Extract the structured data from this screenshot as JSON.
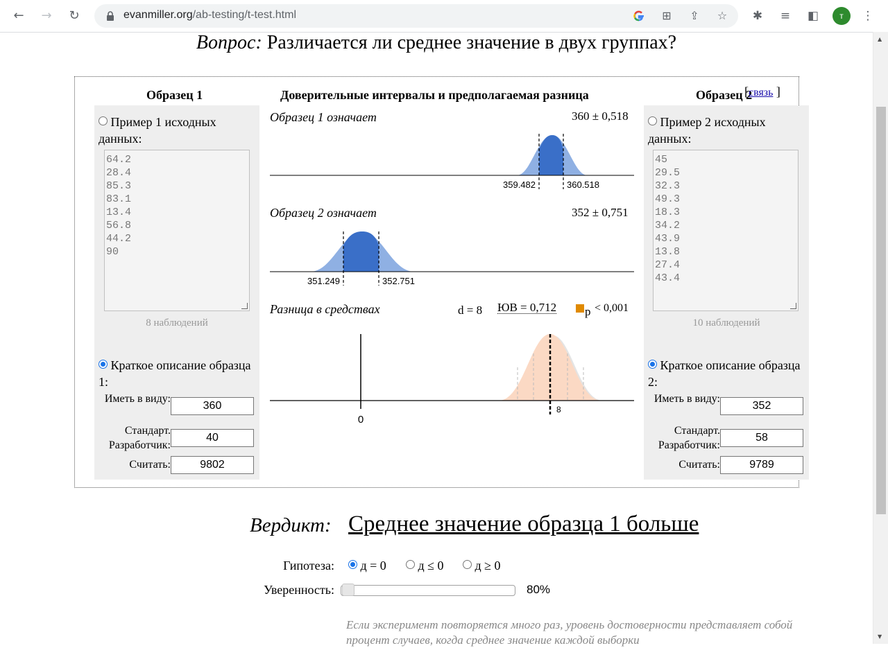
{
  "browser": {
    "url_host": "evanmiller.org",
    "url_path": "/ab-testing/t-test.html",
    "avatar_letter": "т"
  },
  "question": {
    "label": "Вопрос:",
    "text": "Различается ли среднее значение в двух группах?"
  },
  "link": {
    "open": "[",
    "label": "связь",
    "close": "]"
  },
  "sample1": {
    "title": "Образец 1",
    "raw_label": "Пример 1 исходных данных:",
    "raw_values": [
      "64.2",
      "28.4",
      "85.3",
      "83.1",
      "13.4",
      "56.8",
      "44.2",
      "90"
    ],
    "observations": "8 наблюдений",
    "summary_label": "Краткое описание образца 1:",
    "mean_label": "Иметь в виду:",
    "mean": "360",
    "sd_label": "Стандарт. Разработчик:",
    "sd": "40",
    "count_label": "Считать:",
    "count": "9802"
  },
  "sample2": {
    "title": "Образец 2",
    "raw_label": "Пример 2 исходных данных:",
    "raw_values": [
      "45",
      "29.5",
      "32.3",
      "49.3",
      "18.3",
      "34.2",
      "43.9",
      "13.8",
      "27.4",
      "43.4"
    ],
    "observations": "10 наблюдений",
    "summary_label": "Краткое описание образца 2:",
    "mean_label": "Иметь в виду:",
    "mean": "352",
    "sd_label": "Стандарт. Разработчик:",
    "sd": "58",
    "count_label": "Считать:",
    "count": "9789"
  },
  "middle": {
    "title": "Доверительные интервалы и предполагаемая разница",
    "mean1_label": "Образец 1 означает",
    "mean1_value": "360 ± 0,518",
    "mean1_lo": "359.482",
    "mean1_hi": "360.518",
    "mean2_label": "Образец 2 означает",
    "mean2_value": "352 ± 0,751",
    "mean2_lo": "351.249",
    "mean2_hi": "352.751",
    "diff_label": "Разница в средствах",
    "d_label": "d = 8",
    "se_label": "ЮВ = 0,712",
    "p_label": "p",
    "p_value": "< 0,001",
    "diff_zero": "0",
    "diff_tick": "8"
  },
  "colors": {
    "blue": "#3a6fc8",
    "light_blue": "#8fb0e3",
    "peach": "#fbd9c4",
    "orange": "#e08a00"
  },
  "verdict": {
    "label": "Вердикт:",
    "text": "Среднее значение образца 1 больше"
  },
  "hypothesis": {
    "label": "Гипотеза:",
    "options": [
      "д = 0",
      "д ≤ 0",
      "д ≥ 0"
    ],
    "selected": 0
  },
  "confidence": {
    "label": "Уверенность:",
    "value": "80%",
    "level": 0.8
  },
  "footnote": "Если эксперимент повторяется много раз, уровень достоверности представляет собой процент случаев, когда среднее значение каждой выборки"
}
